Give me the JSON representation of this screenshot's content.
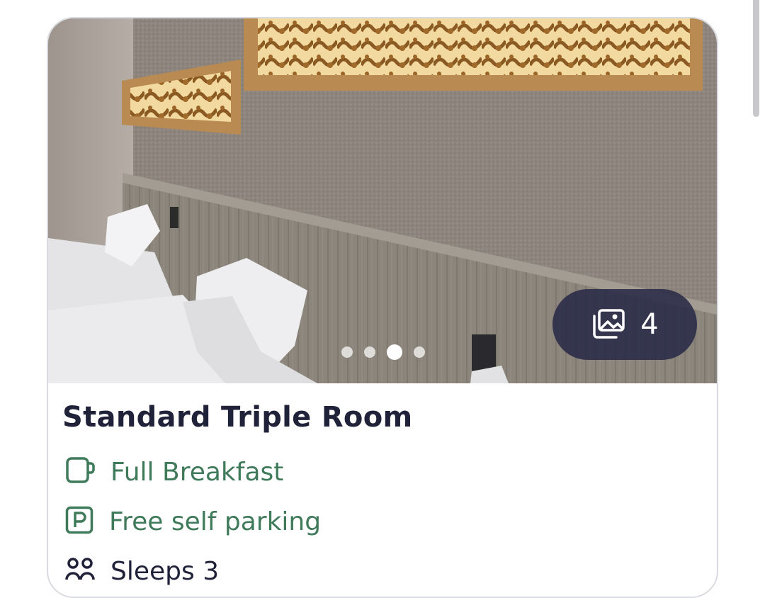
{
  "room": {
    "title": "Standard Triple Room",
    "photo_count": "4",
    "photo_dots": 4,
    "active_photo_index": 2
  },
  "features": [
    {
      "icon": "cup-icon",
      "label": "Full Breakfast",
      "color": "#3f7a5a"
    },
    {
      "icon": "parking-icon",
      "label": "Free self parking",
      "color": "#3f7a5a"
    },
    {
      "icon": "people-icon",
      "label": "Sleeps 3",
      "color": "#1f2238"
    }
  ],
  "colors": {
    "badge_bg": "#262846",
    "title": "#1f2238",
    "feature_green": "#3f7a5a",
    "card_border": "#d9dbe0"
  }
}
